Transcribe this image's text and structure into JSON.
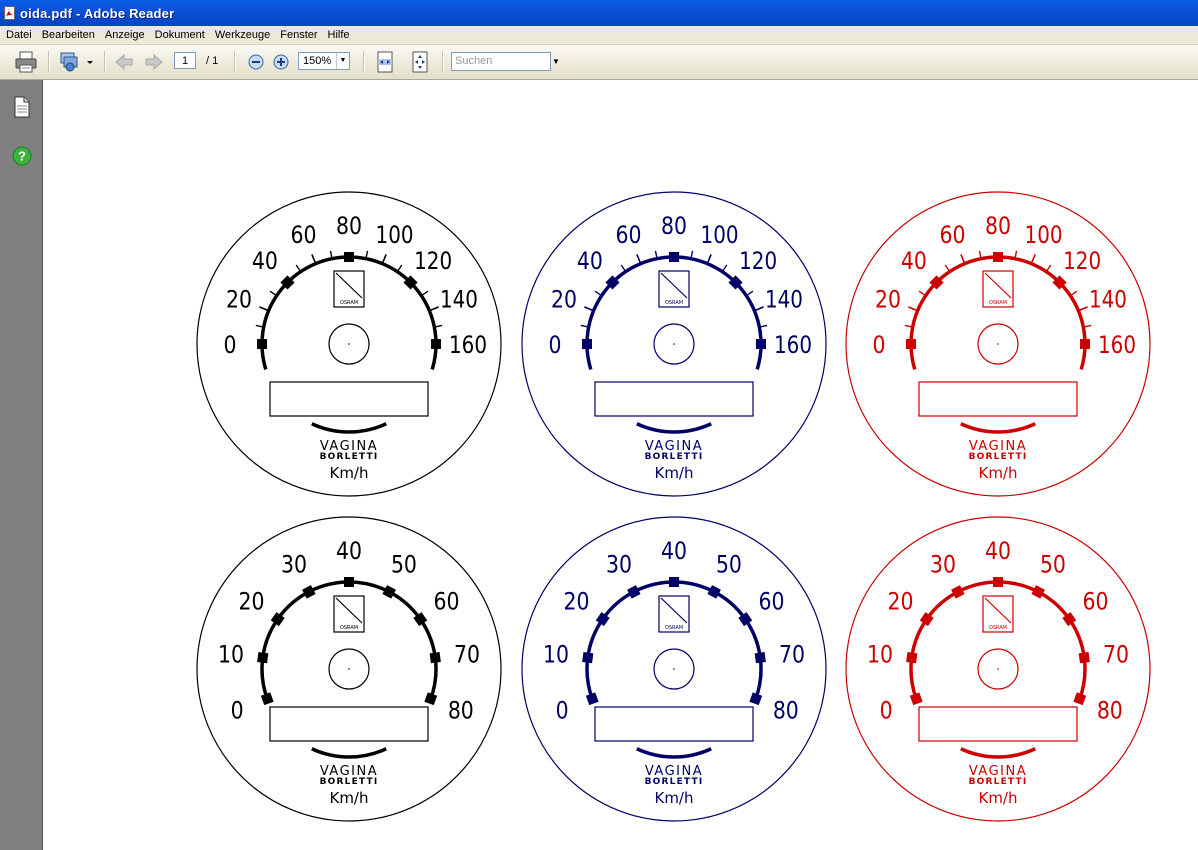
{
  "window": {
    "title": "oida.pdf - Adobe Reader"
  },
  "menu": {
    "items": [
      "Datei",
      "Bearbeiten",
      "Anzeige",
      "Dokument",
      "Werkzeuge",
      "Fenster",
      "Hilfe"
    ]
  },
  "toolbar": {
    "current_page": "1",
    "page_total": "/ 1",
    "zoom_level": "150%",
    "search_placeholder": "Suchen"
  },
  "colors": {
    "black": "#000000",
    "navy": "#000066",
    "red": "#cc0000"
  },
  "gauges": [
    {
      "color": "#000000",
      "labels": [
        "0",
        "20",
        "40",
        "60",
        "80",
        "100",
        "120",
        "140",
        "160"
      ],
      "brand": "VAGINA",
      "maker": "BORLETTI",
      "unit": "Km/h",
      "emblem_text": "OSRAM"
    },
    {
      "color": "#000066",
      "labels": [
        "0",
        "20",
        "40",
        "60",
        "80",
        "100",
        "120",
        "140",
        "160"
      ],
      "brand": "VAGINA",
      "maker": "BORLETTI",
      "unit": "Km/h",
      "emblem_text": "OSRAM"
    },
    {
      "color": "#cc0000",
      "labels": [
        "0",
        "20",
        "40",
        "60",
        "80",
        "100",
        "120",
        "140",
        "160"
      ],
      "brand": "VAGINA",
      "maker": "BORLETTI",
      "unit": "Km/h",
      "emblem_text": "OSRAM"
    },
    {
      "color": "#000000",
      "labels": [
        "0",
        "10",
        "20",
        "30",
        "40",
        "50",
        "60",
        "70",
        "80"
      ],
      "brand": "VAGINA",
      "maker": "BORLETTI",
      "unit": "Km/h",
      "emblem_text": "OSRAM"
    },
    {
      "color": "#000066",
      "labels": [
        "0",
        "10",
        "20",
        "30",
        "40",
        "50",
        "60",
        "70",
        "80"
      ],
      "brand": "VAGINA",
      "maker": "BORLETTI",
      "unit": "Km/h",
      "emblem_text": "OSRAM"
    },
    {
      "color": "#cc0000",
      "labels": [
        "0",
        "10",
        "20",
        "30",
        "40",
        "50",
        "60",
        "70",
        "80"
      ],
      "brand": "VAGINA",
      "maker": "BORLETTI",
      "unit": "Km/h",
      "emblem_text": "OSRAM"
    }
  ],
  "icons": {
    "print": "printer-icon",
    "organizer": "organizer-icon",
    "prev": "arrow-left-icon",
    "next": "arrow-right-icon",
    "zoom_out": "zoom-out-icon",
    "zoom_in": "zoom-in-icon",
    "fit_width": "fit-width-icon",
    "fit_page": "fit-page-icon",
    "pages": "pages-icon",
    "help": "help-icon"
  }
}
